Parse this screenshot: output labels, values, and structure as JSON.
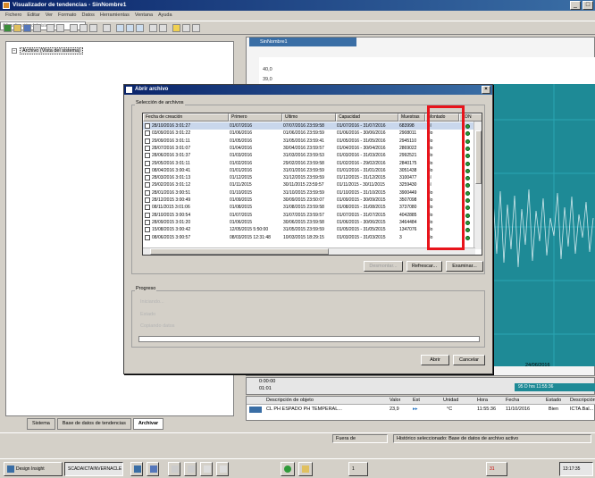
{
  "app": {
    "title": "Visualizador de tendencias - SinNombre1"
  },
  "menu": [
    "Fichero",
    "Editar",
    "Ver",
    "Formato",
    "Datos",
    "Herramientas",
    "Ventana",
    "Ayuda"
  ],
  "toolbar": {
    "selector_value": "(Visualización del sistema)"
  },
  "tree": {
    "root_label": "Archivo (Vista del sistema)"
  },
  "left_tabs": [
    "Sistema",
    "Base de datos de tendencias",
    "Archivar"
  ],
  "chart": {
    "window_title": "SinNombre1",
    "y_labels": [
      "40,0",
      "39,0"
    ],
    "date_label": "24/06/2016",
    "time_top": "0:00:00",
    "time_bottom": "01:01",
    "range_label": "95 D hrs 11:55:36"
  },
  "signals": {
    "headers": [
      "Descripción de objeto",
      "Valor",
      "Est",
      "Unidad",
      "Hora",
      "Fecha",
      "Estado",
      "Descripción"
    ],
    "row": [
      "CL PH ESPADO PH TEMPERAL...",
      "23,9",
      "",
      "°C",
      "11:55:36",
      "11/10/2016",
      "Bien",
      "ICTA.Bal..."
    ]
  },
  "status_bar": {
    "panel1": "Fuera de",
    "panel2": "Histórico seleccionado: Base de datos de archivo activo"
  },
  "taskbar": {
    "item1": "Design Insight",
    "item2": "SCADAICTAINVERNACLE",
    "item3": "1",
    "item4": "31",
    "clock": "13:17:35"
  },
  "dialog": {
    "title": "Abrir archivo",
    "selection_label": "Selección de archivos",
    "columns": [
      "Fecha de creación",
      "Primero",
      "Último",
      "Capacidad",
      "Muestras",
      "Montado",
      "EDN"
    ],
    "rows": [
      {
        "fecha": "28/10/2016 3:01:27",
        "primero": "01/07/2016",
        "ultimo": "07/07/2016 23:59:58",
        "capacidad": "01/07/2016 - 31/07/2016",
        "muestras": "683998",
        "montado": "Sí",
        "sel": true
      },
      {
        "fecha": "03/09/2016 3:01:22",
        "primero": "01/06/2016",
        "ultimo": "01/06/2016 23:59:59",
        "capacidad": "01/06/2016 - 30/06/2016",
        "muestras": "2908011",
        "montado": "No",
        "sel": false
      },
      {
        "fecha": "29/09/2016 3:01:11",
        "primero": "01/05/2016",
        "ultimo": "31/05/2016 23:59:41",
        "capacidad": "01/05/2016 - 31/05/2016",
        "muestras": "2945110",
        "montado": "No",
        "sel": false
      },
      {
        "fecha": "28/07/2016 3:01:07",
        "primero": "01/04/2016",
        "ultimo": "30/04/2016 23:59:57",
        "capacidad": "01/04/2016 - 30/04/2016",
        "muestras": "2869022",
        "montado": "No",
        "sel": false
      },
      {
        "fecha": "28/06/2016 3:01:37",
        "primero": "01/03/2016",
        "ultimo": "31/03/2016 23:59:53",
        "capacidad": "01/03/2016 - 31/03/2016",
        "muestras": "2992521",
        "montado": "No",
        "sel": false
      },
      {
        "fecha": "29/05/2016 3:01:11",
        "primero": "01/02/2016",
        "ultimo": "29/02/2016 23:59:58",
        "capacidad": "01/02/2016 - 29/02/2016",
        "muestras": "2840175",
        "montado": "No",
        "sel": false
      },
      {
        "fecha": "08/04/2016 3:00:41",
        "primero": "01/01/2016",
        "ultimo": "31/01/2016 23:59:59",
        "capacidad": "01/01/2016 - 31/01/2016",
        "muestras": "3051438",
        "montado": "No",
        "sel": false
      },
      {
        "fecha": "28/03/2016 3:01:13",
        "primero": "01/12/2015",
        "ultimo": "31/12/2015 23:59:59",
        "capacidad": "01/12/2015 - 31/12/2015",
        "muestras": "3100477",
        "montado": "Sí",
        "sel": false
      },
      {
        "fecha": "29/02/2016 3:01:12",
        "primero": "01/11/2015",
        "ultimo": "30/11/2015 23:59:57",
        "capacidad": "01/11/2015 - 30/11/2015",
        "muestras": "3259430",
        "montado": "Sí",
        "sel": false
      },
      {
        "fecha": "28/01/2016 3:00:51",
        "primero": "01/10/2015",
        "ultimo": "31/10/2015 23:59:59",
        "capacidad": "01/10/2015 - 31/10/2015",
        "muestras": "3900449",
        "montado": "No",
        "sel": false
      },
      {
        "fecha": "28/12/2015 3:00:49",
        "primero": "01/09/2015",
        "ultimo": "30/09/2015 23:50:07",
        "capacidad": "01/09/2015 - 30/09/2015",
        "muestras": "3507098",
        "montado": "No",
        "sel": false
      },
      {
        "fecha": "08/11/2015 3:01:06",
        "primero": "01/08/2015",
        "ultimo": "31/08/2015 23:59:58",
        "capacidad": "01/08/2015 - 31/08/2015",
        "muestras": "3737080",
        "montado": "No",
        "sel": false
      },
      {
        "fecha": "28/10/2015 3:00:54",
        "primero": "01/07/2015",
        "ultimo": "31/07/2015 23:59:57",
        "capacidad": "01/07/2015 - 31/07/2015",
        "muestras": "4042885",
        "montado": "No",
        "sel": false
      },
      {
        "fecha": "28/09/2015 3:01:20",
        "primero": "01/06/2015",
        "ultimo": "30/06/2015 23:59:58",
        "capacidad": "01/06/2015 - 30/06/2015",
        "muestras": "3464484",
        "montado": "No",
        "sel": false
      },
      {
        "fecha": "15/08/2015 3:00:42",
        "primero": "12/05/2015 5:50:00",
        "ultimo": "31/05/2015 23:59:59",
        "capacidad": "01/05/2015 - 31/05/2015",
        "muestras": "1347076",
        "montado": "No",
        "sel": false
      },
      {
        "fecha": "08/06/2015 3:00:57",
        "primero": "08/03/2015 12:31:48",
        "ultimo": "10/03/2015 18:29:15",
        "capacidad": "01/03/2015 - 31/03/2015",
        "muestras": "3",
        "montado": "No",
        "sel": false
      }
    ],
    "buttons": {
      "disabled": "Desmontar...",
      "refresh": "Refrescar...",
      "browse": "Examinar...",
      "open": "Abrir",
      "cancel": "Cancelar"
    },
    "progress": {
      "label": "Progreso",
      "line1": "Iniciando...",
      "line2": "Estado",
      "line3": "Copiando datos"
    }
  }
}
